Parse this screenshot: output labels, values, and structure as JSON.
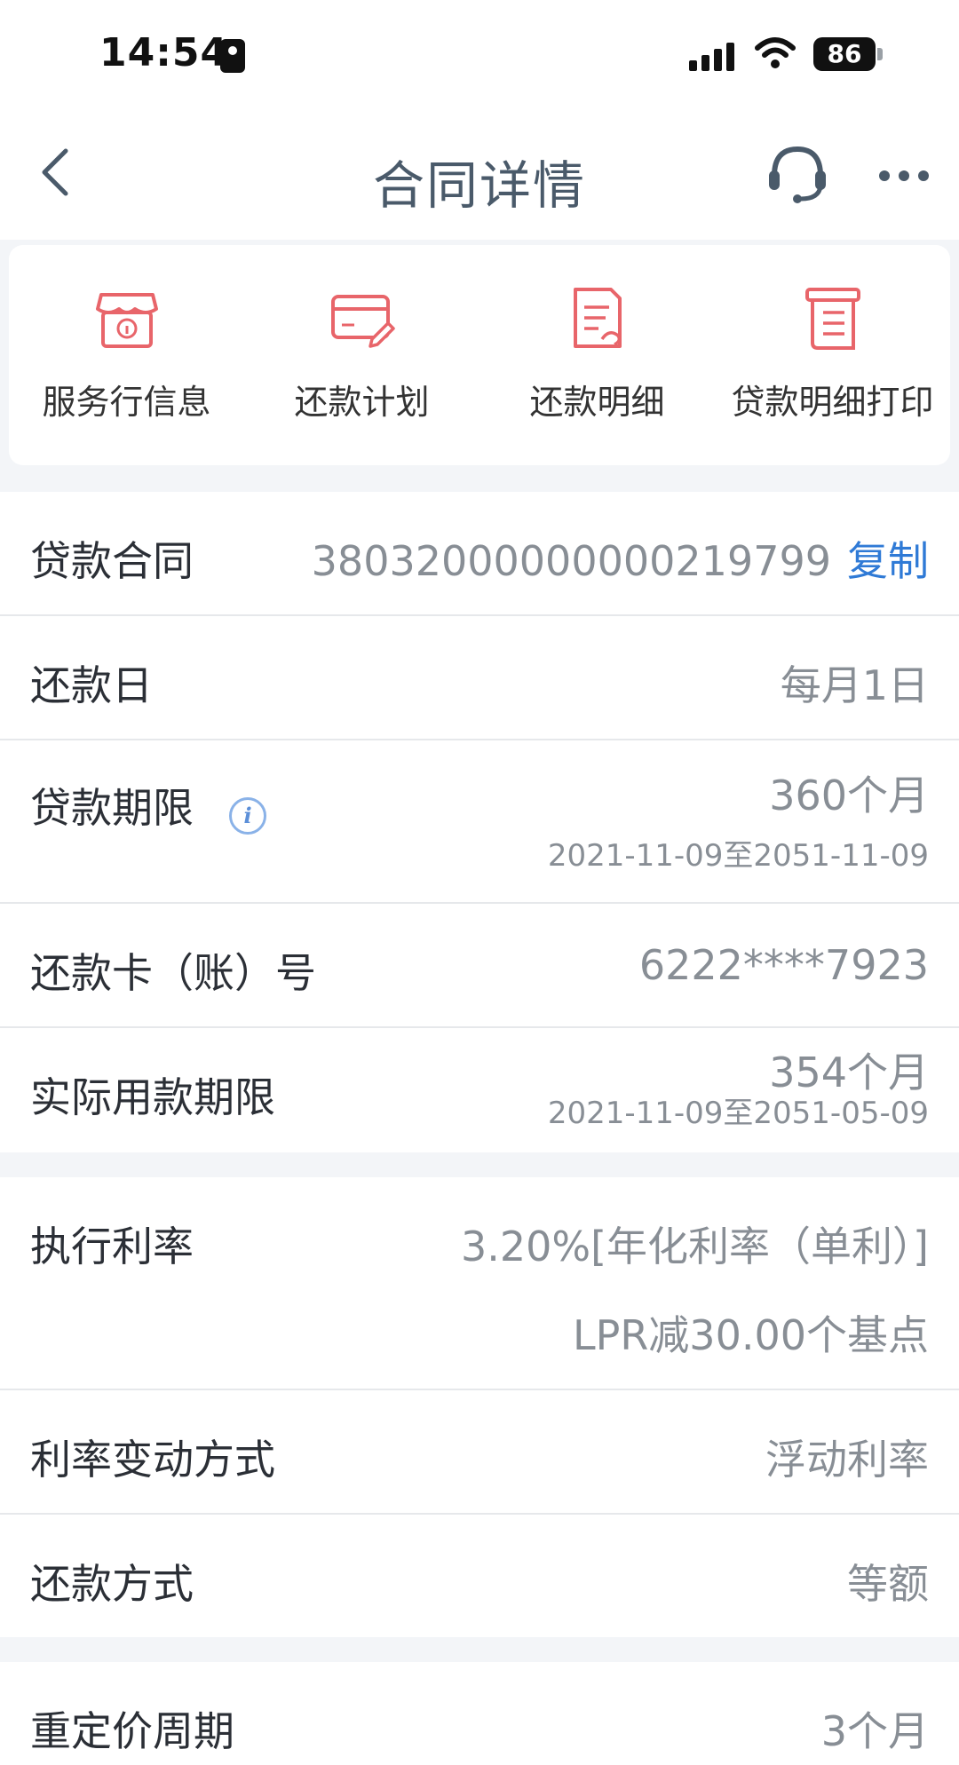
{
  "status_bar": {
    "time": "14:54",
    "battery": "86"
  },
  "nav": {
    "title": "合同详情",
    "back_icon": "chevron-left-icon",
    "support_icon": "headset-icon",
    "more_icon": "more-dots-icon"
  },
  "actions": [
    {
      "label": "服务行信息",
      "icon": "store-info-icon"
    },
    {
      "label": "还款计划",
      "icon": "card-edit-icon"
    },
    {
      "label": "还款明细",
      "icon": "document-detail-icon"
    },
    {
      "label": "贷款明细打印",
      "icon": "receipt-print-icon"
    }
  ],
  "details": {
    "contract": {
      "label": "贷款合同",
      "value": "38032000000000219799",
      "copy": "复制"
    },
    "repay_day": {
      "label": "还款日",
      "value": "每月1日"
    },
    "term": {
      "label": "贷款期限",
      "value": "360个月",
      "range": "2021-11-09至2051-11-09"
    },
    "card": {
      "label": "还款卡（账）号",
      "value": "6222****7923"
    },
    "actual_term": {
      "label": "实际用款期限",
      "value": "354个月",
      "range": "2021-11-09至2051-05-09"
    }
  },
  "rate": {
    "exec": {
      "label": "执行利率",
      "value": "3.20%[年化利率（单利）]",
      "sub": "LPR减30.00个基点"
    },
    "change": {
      "label": "利率变动方式",
      "value": "浮动利率"
    },
    "method": {
      "label": "还款方式",
      "value": "等额"
    }
  },
  "reprice": {
    "label": "重定价周期",
    "value": "3个月"
  },
  "colors": {
    "accent": "#2f7ad6",
    "icon_red": "#e8656a",
    "title": "#4a5a6a"
  }
}
